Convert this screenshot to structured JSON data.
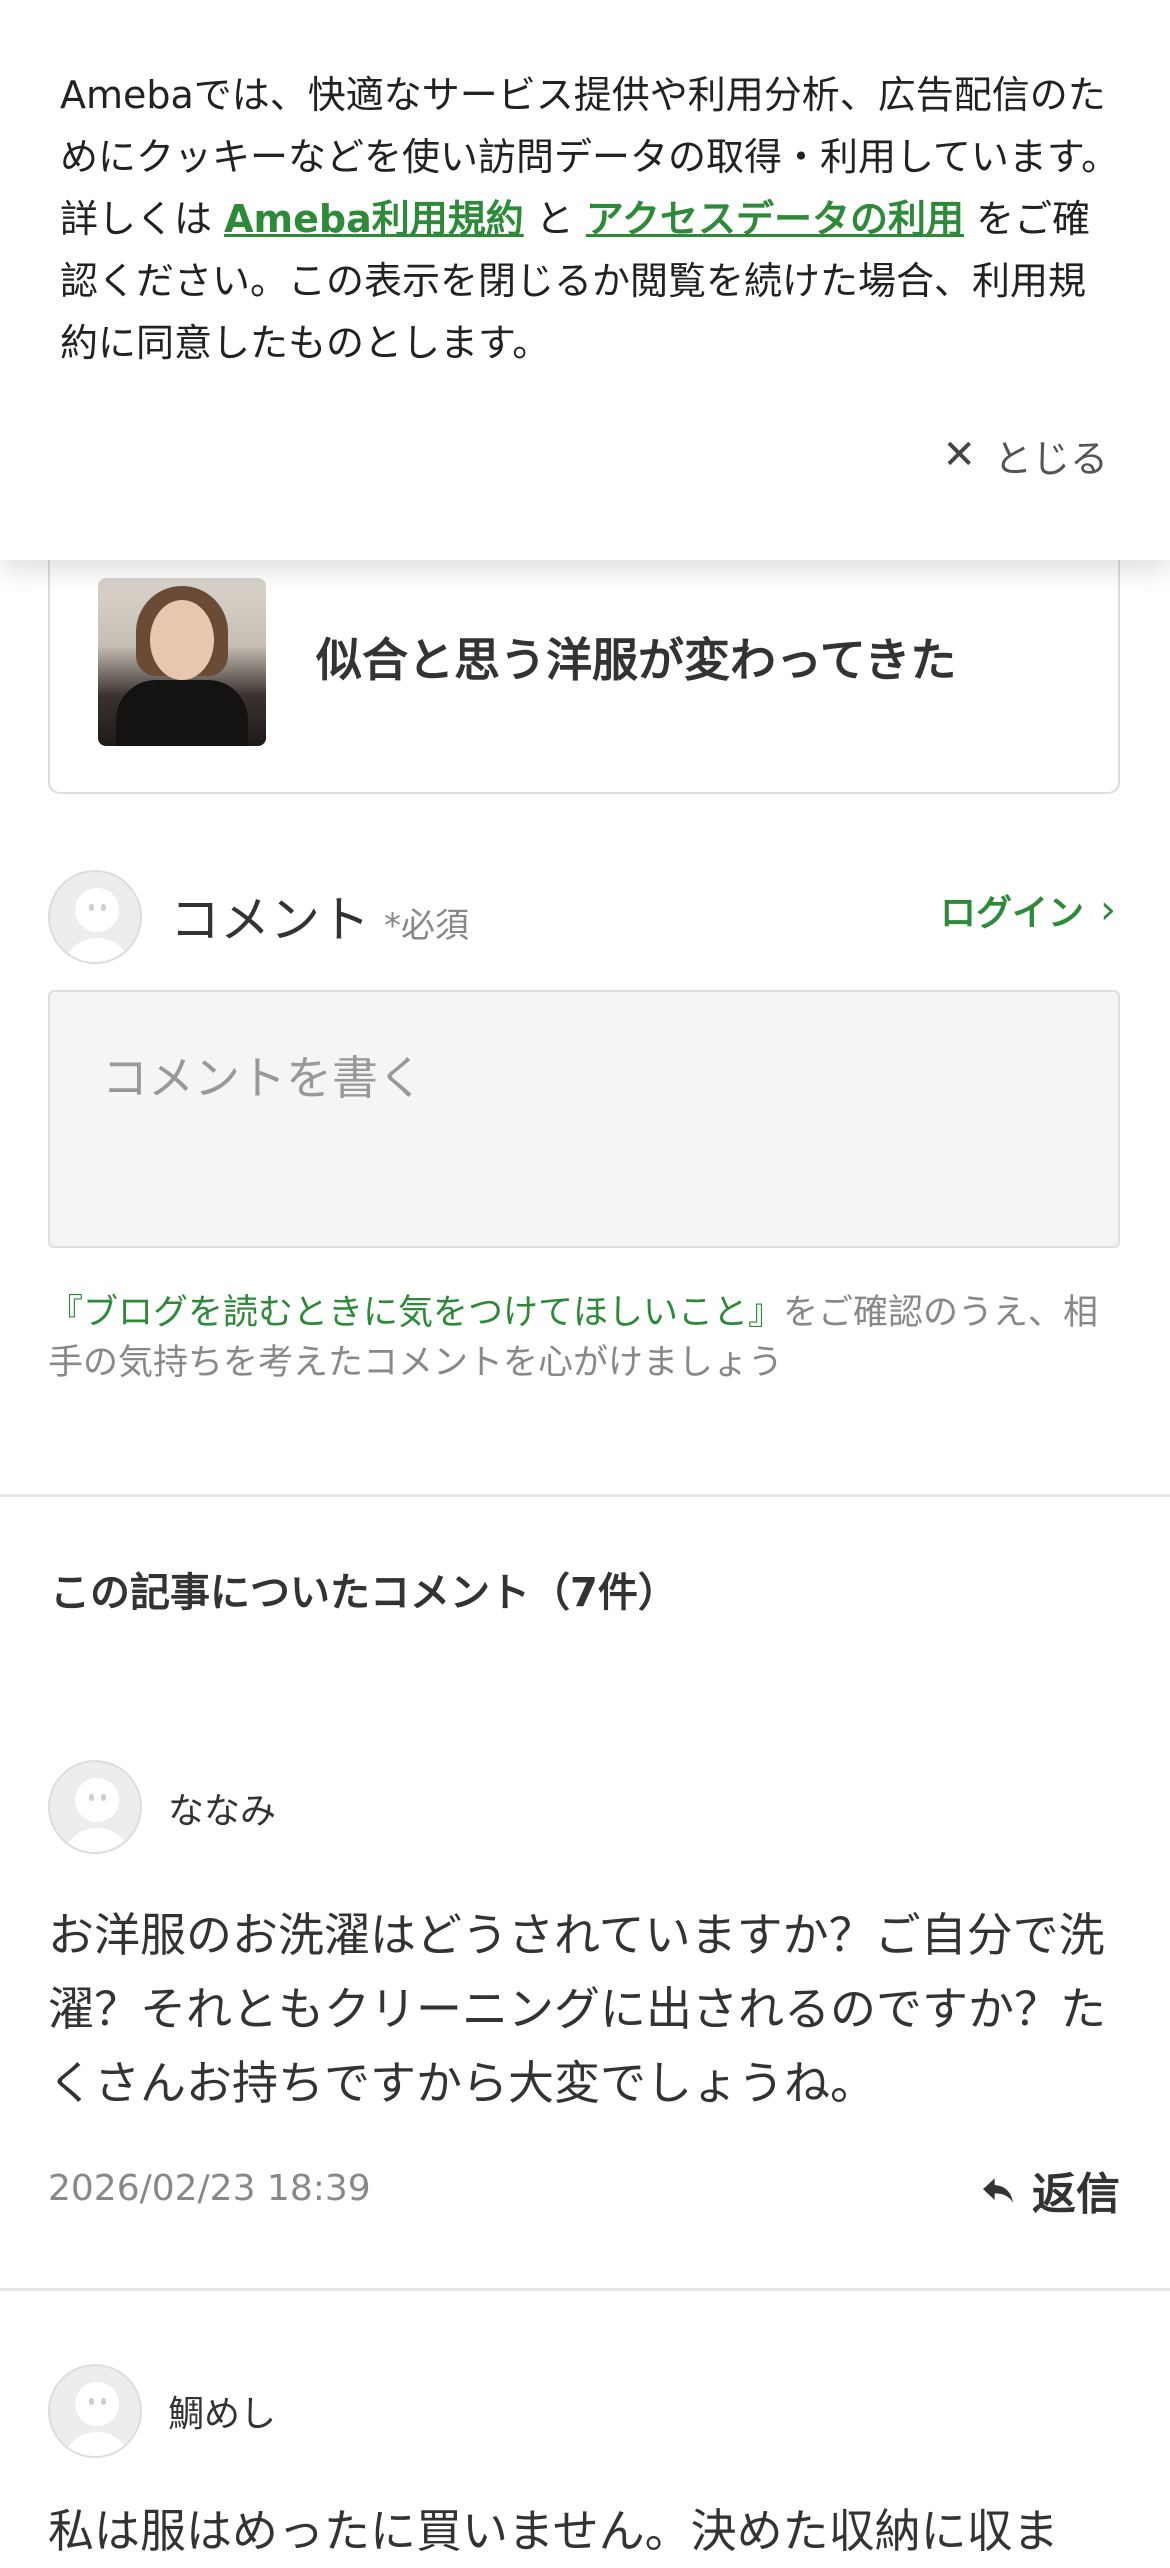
{
  "cookie_banner": {
    "text_part1": "Amebaでは、快適なサービス提供や利用分析、広告配信のためにクッキーなどを使い訪問データの取得・利用しています。詳しくは ",
    "link_terms": "Ameba利用規約",
    "text_part2": " と ",
    "link_access": "アクセスデータの利用",
    "text_part3": " をご確認ください。この表示を閉じるか閲覧を続けた場合、利用規約に同意したものとします。",
    "close_label": "とじる",
    "link_color": "#2d8a38"
  },
  "article": {
    "title": "似合と思う洋服が変わってきた"
  },
  "comment_form": {
    "label": "コメント",
    "required": "*必須",
    "login": "ログイン",
    "placeholder": "コメントを書く",
    "notice_link": "『ブログを読むときに気をつけてほしいこと』",
    "notice_text": "をご確認のうえ、相手の気持ちを考えたコメントを心がけましょう"
  },
  "comments_section": {
    "title": "この記事についたコメント（7件）",
    "reply_label": "返信",
    "comments": [
      {
        "author": "ななみ",
        "body": "お洋服のお洗濯はどうされていますか？ご自分で洗濯？それともクリーニングに出されるのですか？たくさんお持ちですから大変でしょうね。",
        "date": "2026/02/23 18:39"
      },
      {
        "author": "鯛めし",
        "body": "私は服はめったに買いません。決めた収納に収ま"
      }
    ]
  }
}
